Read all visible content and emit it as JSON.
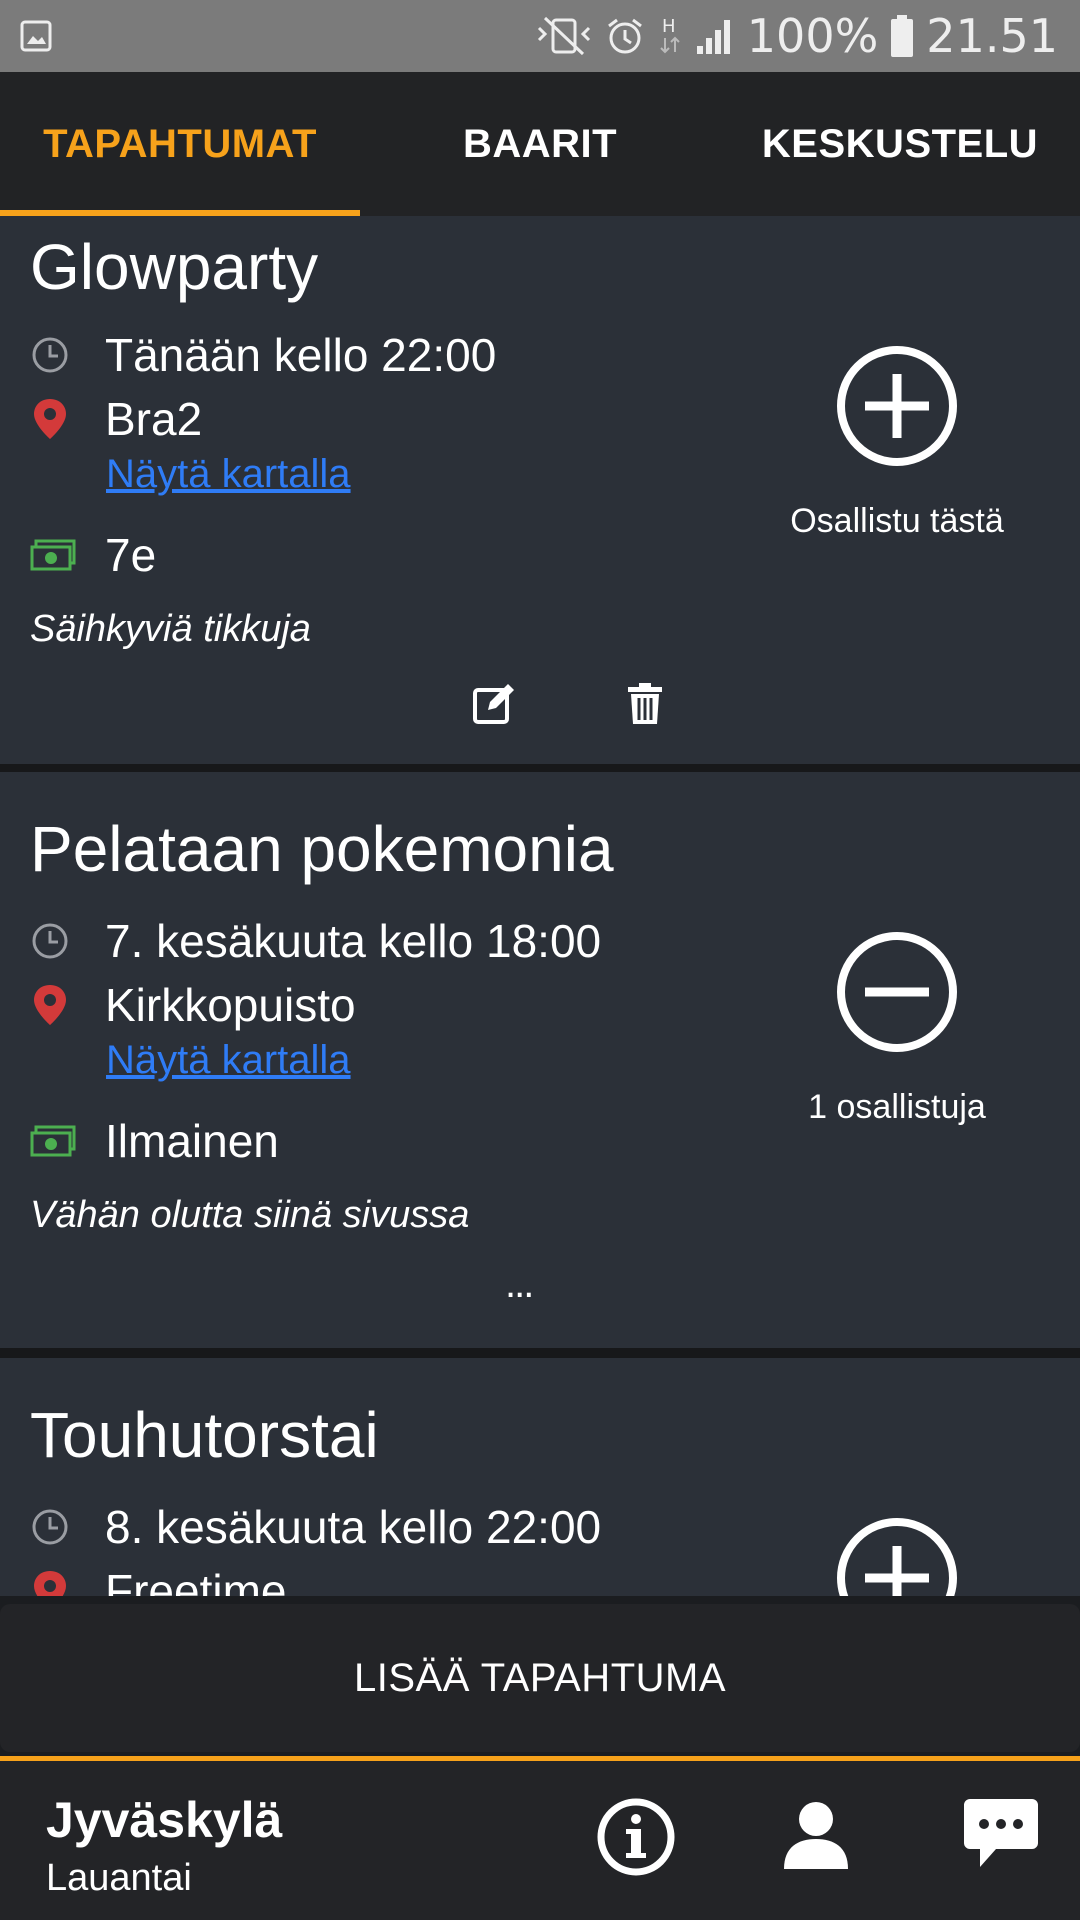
{
  "status_bar": {
    "battery": "100%",
    "time": "21.51",
    "icons": [
      "image-icon",
      "vibrate-mute-icon",
      "alarm-icon",
      "data-h-icon",
      "signal-icon",
      "battery-icon"
    ]
  },
  "tabs": [
    {
      "label": "TAPAHTUMAT",
      "active": true
    },
    {
      "label": "BAARIT",
      "active": false
    },
    {
      "label": "KESKUSTELU",
      "active": false
    }
  ],
  "events": [
    {
      "title": "Glowparty",
      "time": "Tänään kello 22:00",
      "place": "Bra2",
      "map_link": "Näytä kartalla",
      "price": "7e",
      "description": "Säihkyviä tikkuja",
      "action_icon": "plus-circle-icon",
      "action_label": "Osallistu tästä"
    },
    {
      "title": "Pelataan pokemonia",
      "time": "7. kesäkuuta kello 18:00",
      "place": "Kirkkopuisto",
      "map_link": "Näytä kartalla",
      "price": "Ilmainen",
      "description": "Vähän olutta siinä sivussa",
      "action_icon": "minus-circle-icon",
      "action_label": "1 osallistuja",
      "more": "..."
    },
    {
      "title": "Touhutorstai",
      "time": "8. kesäkuuta kello 22:00",
      "place": "Freetime",
      "action_icon": "plus-circle-icon"
    }
  ],
  "add_event_button": "LISÄÄ TAPAHTUMA",
  "footer": {
    "city": "Jyväskylä",
    "day": "Lauantai"
  },
  "colors": {
    "accent": "#f7a21b",
    "card_bg": "#2b3038",
    "link": "#2f7cf6",
    "location_pin": "#d33a3a",
    "money": "#4caf50"
  }
}
